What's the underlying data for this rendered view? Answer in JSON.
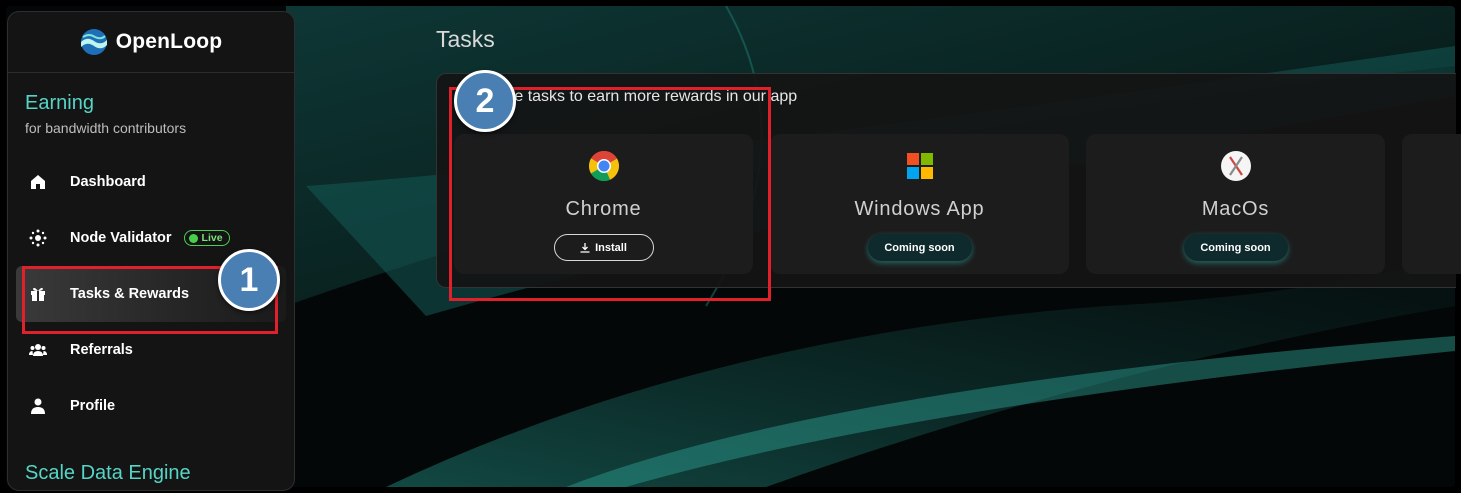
{
  "brand": {
    "name": "OpenLoop",
    "logo_icon": "openloop-wave-logo"
  },
  "sidebar": {
    "section1_title": "Earning",
    "section1_subtitle": "for bandwidth contributors",
    "items": [
      {
        "label": "Dashboard",
        "icon": "home-icon"
      },
      {
        "label": "Node Validator",
        "icon": "node-icon",
        "badge": "Live"
      },
      {
        "label": "Tasks & Rewards",
        "icon": "gift-icon",
        "active": true
      },
      {
        "label": "Referrals",
        "icon": "users-icon"
      },
      {
        "label": "Profile",
        "icon": "user-icon"
      }
    ],
    "section2_title": "Scale Data Engine"
  },
  "main": {
    "title": "Tasks",
    "subtitle": "ete tasks to earn more rewards in our app",
    "cards": [
      {
        "name": "Chrome",
        "icon": "chrome-icon",
        "action": "Install"
      },
      {
        "name": "Windows App",
        "icon": "windows-icon",
        "status": "Coming soon"
      },
      {
        "name": "MacOs",
        "icon": "macos-icon",
        "status": "Coming soon"
      }
    ]
  },
  "annotations": [
    {
      "number": "1"
    },
    {
      "number": "2"
    }
  ],
  "colors": {
    "accent": "#56d5c6",
    "live": "#49d049",
    "highlight": "#e0202a",
    "marker": "#4a7fb4"
  }
}
